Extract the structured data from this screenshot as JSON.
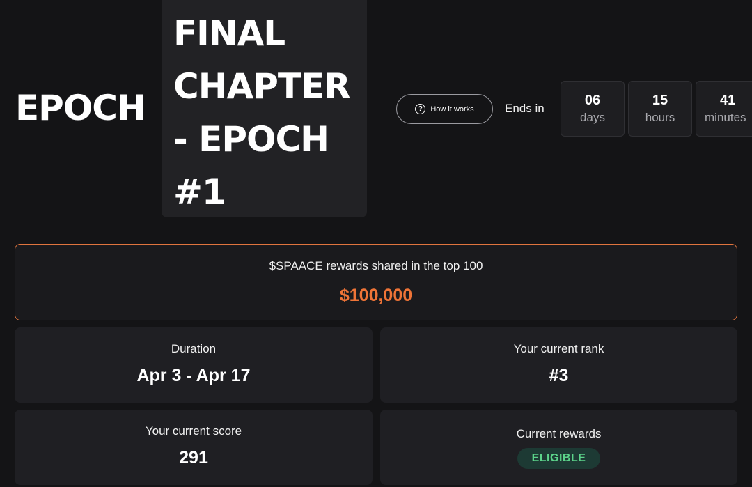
{
  "header": {
    "epoch_label": "EPOCH",
    "chapter_title": "FINAL\nCHAPTER\n- EPOCH\n#1",
    "how_it_works_label": "How it works",
    "help_icon_glyph": "?",
    "ends_in_label": "Ends in"
  },
  "countdown": [
    {
      "value": "06",
      "unit": "days"
    },
    {
      "value": "15",
      "unit": "hours"
    },
    {
      "value": "41",
      "unit": "minutes"
    }
  ],
  "rewards_pool": {
    "label": "$SPAACE rewards shared in the top 100",
    "value": "$100,000"
  },
  "stats": {
    "duration": {
      "label": "Duration",
      "value": "Apr 3 - Apr 17"
    },
    "rank": {
      "label": "Your current rank",
      "value": "#3"
    },
    "score": {
      "label": "Your current score",
      "value": "291"
    },
    "current_rewards": {
      "label": "Current rewards",
      "status": "ELIGIBLE"
    }
  },
  "colors": {
    "accent_orange": "#ef7437",
    "eligible_green": "#5cd38a",
    "background": "#141416",
    "card_background": "#1f1f23"
  }
}
